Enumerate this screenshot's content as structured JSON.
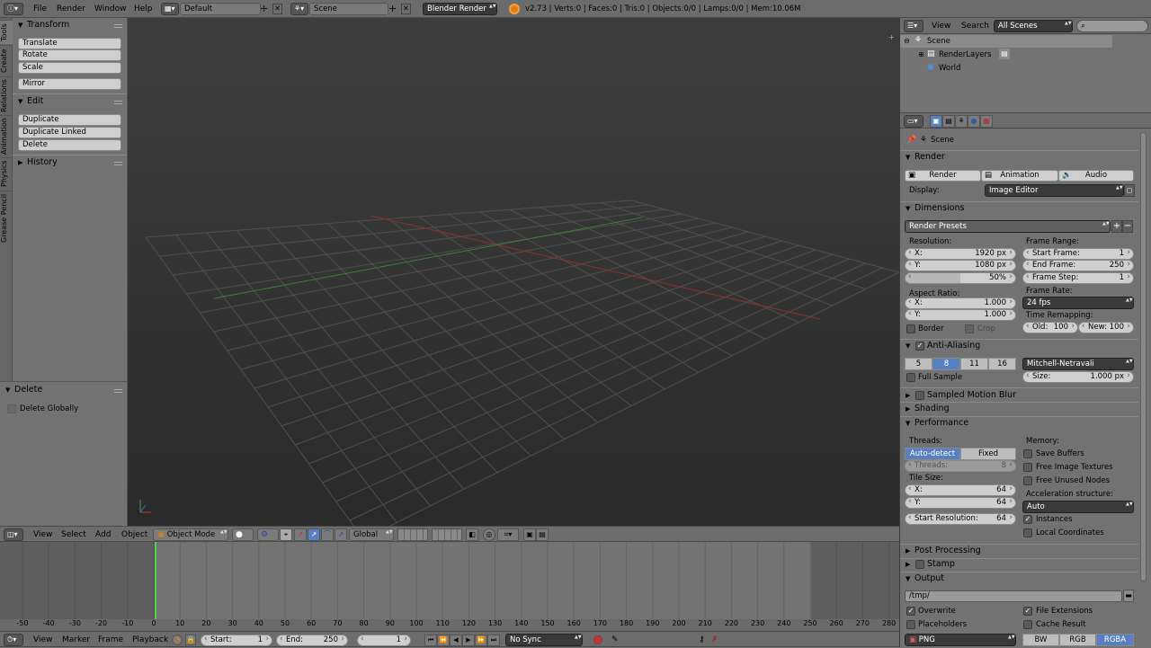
{
  "topbar": {
    "menus": [
      "File",
      "Render",
      "Window",
      "Help"
    ],
    "layout": "Default",
    "scene": "Scene",
    "engine": "Blender Render",
    "stats": "v2.73 | Verts:0 | Faces:0 | Tris:0 | Objects:0/0 | Lamps:0/0 | Mem:10.06M"
  },
  "toolshelf": {
    "tabs": [
      "Tools",
      "Create",
      "Relations",
      "Animation",
      "Physics",
      "Grease Pencil"
    ],
    "transform_title": "Transform",
    "transform_buttons": [
      "Translate",
      "Rotate",
      "Scale"
    ],
    "mirror": "Mirror",
    "edit_title": "Edit",
    "edit_buttons": [
      "Duplicate",
      "Duplicate Linked",
      "Delete"
    ],
    "history_title": "History",
    "delete_title": "Delete",
    "delete_globally": "Delete Globally"
  },
  "viewport_header": {
    "menus": [
      "View",
      "Select",
      "Add",
      "Object"
    ],
    "mode": "Object Mode",
    "orientation": "Global"
  },
  "timeline": {
    "ticks": [
      "-50",
      "-40",
      "-30",
      "-20",
      "-10",
      "0",
      "10",
      "20",
      "30",
      "40",
      "50",
      "60",
      "70",
      "80",
      "90",
      "100",
      "110",
      "120",
      "130",
      "140",
      "150",
      "160",
      "170",
      "180",
      "190",
      "200",
      "210",
      "220",
      "230",
      "240",
      "250",
      "260",
      "270",
      "280"
    ],
    "menus": [
      "View",
      "Marker",
      "Frame",
      "Playback"
    ],
    "start_label": "Start:",
    "start": "1",
    "end_label": "End:",
    "end": "250",
    "current": "1",
    "sync": "No Sync"
  },
  "outliner": {
    "menus": [
      "View",
      "Search"
    ],
    "filter": "All Scenes",
    "items": [
      "Scene",
      "RenderLayers",
      "World"
    ]
  },
  "properties": {
    "context": "Scene",
    "render": {
      "title": "Render",
      "buttons": [
        "Render",
        "Animation",
        "Audio"
      ],
      "display_label": "Display:",
      "display": "Image Editor"
    },
    "dimensions": {
      "title": "Dimensions",
      "presets": "Render Presets",
      "resolution_label": "Resolution:",
      "res_x_l": "X:",
      "res_x": "1920 px",
      "res_y_l": "Y:",
      "res_y": "1080 px",
      "res_pct": "50%",
      "aspect_label": "Aspect Ratio:",
      "asp_x_l": "X:",
      "asp_x": "1.000",
      "asp_y_l": "Y:",
      "asp_y": "1.000",
      "border": "Border",
      "crop": "Crop",
      "frame_range_label": "Frame Range:",
      "start_l": "Start Frame:",
      "start": "1",
      "end_l": "End Frame:",
      "end": "250",
      "step_l": "Frame Step:",
      "step": "1",
      "frame_rate_label": "Frame Rate:",
      "fps": "24 fps",
      "remap_label": "Time Remapping:",
      "old_l": "Old:",
      "old": "100",
      "new_l": "New:",
      "new": "100"
    },
    "aa": {
      "title": "Anti-Aliasing",
      "samples": [
        "5",
        "8",
        "11",
        "16"
      ],
      "filter": "Mitchell-Netravali",
      "full_sample": "Full Sample",
      "size_l": "Size:",
      "size": "1.000 px"
    },
    "motion_blur": "Sampled Motion Blur",
    "shading": "Shading",
    "performance": {
      "title": "Performance",
      "threads_label": "Threads:",
      "autodetect": "Auto-detect",
      "fixed": "Fixed",
      "threads_l": "Threads:",
      "threads": "8",
      "tile_label": "Tile Size:",
      "tx_l": "X:",
      "tx": "64",
      "ty_l": "Y:",
      "ty": "64",
      "startres_l": "Start Resolution:",
      "startres": "64",
      "memory_label": "Memory:",
      "save_buffers": "Save Buffers",
      "free_image": "Free Image Textures",
      "free_nodes": "Free Unused Nodes",
      "accel_label": "Acceleration structure:",
      "accel": "Auto",
      "instances": "Instances",
      "local_coords": "Local Coordinates"
    },
    "post": "Post Processing",
    "stamp": "Stamp",
    "output": {
      "title": "Output",
      "path": "/tmp/",
      "overwrite": "Overwrite",
      "file_ext": "File Extensions",
      "placeholders": "Placeholders",
      "cache": "Cache Result",
      "format": "PNG",
      "bw": "BW",
      "rgb": "RGB",
      "rgba": "RGBA"
    }
  },
  "colors": {
    "accent": "#5680c2",
    "header": "#6c6c6c",
    "viewport_top": "#3d3d3d",
    "viewport_bottom": "#2a2a2a"
  }
}
